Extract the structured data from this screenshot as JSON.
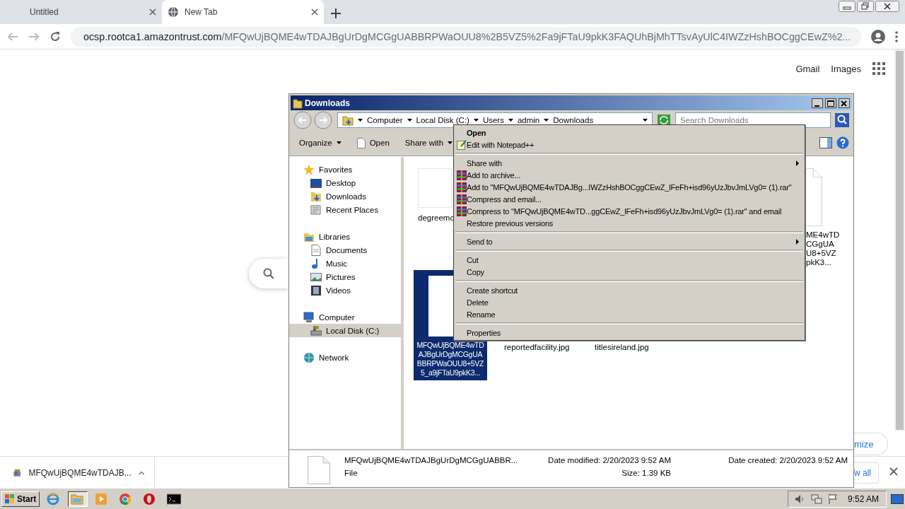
{
  "browser": {
    "tabs": [
      {
        "label": "Untitled",
        "selected": false
      },
      {
        "label": "New Tab",
        "selected": true
      }
    ],
    "address": {
      "host": "ocsp.rootca1.amazontrust.com",
      "path": "/MFQwUjBQME4wTDAJBgUrDgMCGgUABBRPWaOUU8%2B5VZ5%2Fa9jFTaU9pkK3FAQUhBjMhTTsvAyUlC4IWZzHshBOCggCEwZ%2..."
    }
  },
  "page": {
    "links": [
      "Gmail",
      "Images"
    ],
    "customize": "mize",
    "show_all": "w all"
  },
  "downloads_shelf": {
    "item": "MFQwUjBQME4wTDAJB..."
  },
  "explorer": {
    "title": "Downloads",
    "breadcrumb": [
      "Computer",
      "Local Disk (C:)",
      "Users",
      "admin",
      "Downloads"
    ],
    "search": {
      "placeholder": "Search Downloads"
    },
    "toolbar": [
      {
        "label": "Organize",
        "dropdown": true
      },
      {
        "label": "Open",
        "dropdown": false
      },
      {
        "label": "Share with",
        "dropdown": true
      }
    ],
    "nav": [
      {
        "label": "Favorites",
        "selected": false,
        "children": [
          {
            "label": "Desktop",
            "selected": false
          },
          {
            "label": "Downloads",
            "selected": false
          },
          {
            "label": "Recent Places",
            "selected": false
          }
        ]
      },
      {
        "label": "Libraries",
        "selected": false,
        "children": [
          {
            "label": "Documents",
            "selected": false
          },
          {
            "label": "Music",
            "selected": false
          },
          {
            "label": "Pictures",
            "selected": false
          },
          {
            "label": "Videos",
            "selected": false
          }
        ]
      },
      {
        "label": "Computer",
        "selected": false,
        "children": [
          {
            "label": "Local Disk (C:)",
            "selected": true
          }
        ]
      },
      {
        "label": "Network",
        "selected": false
      }
    ],
    "files": [
      {
        "kind": "thumbnail",
        "lines": [
          "degreemc"
        ],
        "selected": false
      },
      {
        "kind": "partial",
        "lines": [
          "ME4wTD",
          "CGgUA",
          "U8+5VZ",
          "pkK3..."
        ],
        "selected": false
      },
      {
        "kind": "document",
        "lines": [
          "MFQwUjBQME4wTD",
          "AJBgUrDgMCGgUA",
          "BBRPWaOUU8+5VZ",
          "5_a9jFTaU9pkK3..."
        ],
        "selected": true
      },
      {
        "kind": "label",
        "lines": [
          "reportedfacility.jpg"
        ],
        "selected": false
      },
      {
        "kind": "label",
        "lines": [
          "titlesireland.jpg"
        ],
        "selected": false
      }
    ],
    "details": {
      "name": "MFQwUjBQME4wTDAJBgUrDgMCGgUABBR...",
      "type": "File",
      "modified": "Date modified: 2/20/2023 9:52 AM",
      "size": "Size: 1.39 KB",
      "created": "Date created: 2/20/2023 9:52 AM"
    }
  },
  "context_menu": [
    {
      "kind": "default",
      "label": "Open",
      "submenu": false
    },
    {
      "kind": "notepad",
      "label": "Edit with Notepad++",
      "submenu": false
    },
    {
      "kind": "separator"
    },
    {
      "kind": "item",
      "label": "Share with",
      "submenu": true
    },
    {
      "kind": "archive",
      "label": "Add to archive...",
      "submenu": false
    },
    {
      "kind": "archive",
      "label": "Add to \"MFQwUjBQME4wTDAJBg...IWZzHshBOCggCEwZ_lFeFh+isd96yUzJbvJmLVg0= (1).rar\"",
      "submenu": false
    },
    {
      "kind": "archive",
      "label": "Compress and email...",
      "submenu": false
    },
    {
      "kind": "archive",
      "label": "Compress to \"MFQwUjBQME4wTD...ggCEwZ_lFeFh+isd96yUzJbvJmLVg0= (1).rar\" and email",
      "submenu": false
    },
    {
      "kind": "item",
      "label": "Restore previous versions",
      "submenu": false
    },
    {
      "kind": "separator"
    },
    {
      "kind": "item",
      "label": "Send to",
      "submenu": true
    },
    {
      "kind": "separator"
    },
    {
      "kind": "item",
      "label": "Cut",
      "submenu": false
    },
    {
      "kind": "item",
      "label": "Copy",
      "submenu": false
    },
    {
      "kind": "separator"
    },
    {
      "kind": "item",
      "label": "Create shortcut",
      "submenu": false
    },
    {
      "kind": "item",
      "label": "Delete",
      "submenu": false
    },
    {
      "kind": "item",
      "label": "Rename",
      "submenu": false
    },
    {
      "kind": "separator"
    },
    {
      "kind": "item",
      "label": "Properties",
      "submenu": false
    }
  ],
  "taskbar": {
    "start": "Start",
    "apps": [
      {
        "kind": "ie",
        "selected": false
      },
      {
        "kind": "explorer",
        "selected": true
      },
      {
        "kind": "media",
        "selected": false
      },
      {
        "kind": "chrome",
        "selected": false
      },
      {
        "kind": "opera",
        "selected": false
      },
      {
        "kind": "cmd",
        "selected": false
      }
    ],
    "clock": "9:52 AM"
  }
}
